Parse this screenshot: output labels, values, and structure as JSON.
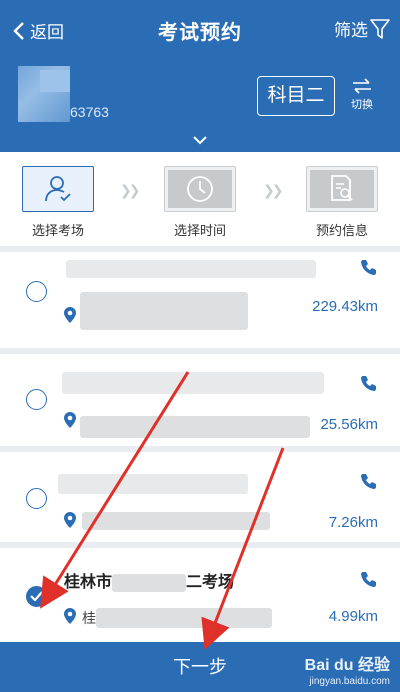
{
  "header": {
    "back_label": "返回",
    "title": "考试预约",
    "filter_label": "筛选",
    "id_partial": "63763",
    "subject": "科目二",
    "switch_label": "切换"
  },
  "steps": [
    {
      "label": "选择考场",
      "active": true
    },
    {
      "label": "选择时间",
      "active": false
    },
    {
      "label": "预约信息",
      "active": false
    }
  ],
  "venues": [
    {
      "distance": "229.43km",
      "selected": false
    },
    {
      "distance": "25.56km",
      "selected": false
    },
    {
      "distance": "7.26km",
      "selected": false
    },
    {
      "name_prefix": "桂林市",
      "name_suffix": "二考场",
      "address_prefix": "桂",
      "distance": "4.99km",
      "selected": true
    }
  ],
  "bottom": {
    "next_label": "下一步"
  },
  "watermark": {
    "brand": "Bai du 经验",
    "url": "jingyan.baidu.com"
  },
  "colors": {
    "primary": "#2b6db5",
    "annotation": "#e0302a"
  }
}
